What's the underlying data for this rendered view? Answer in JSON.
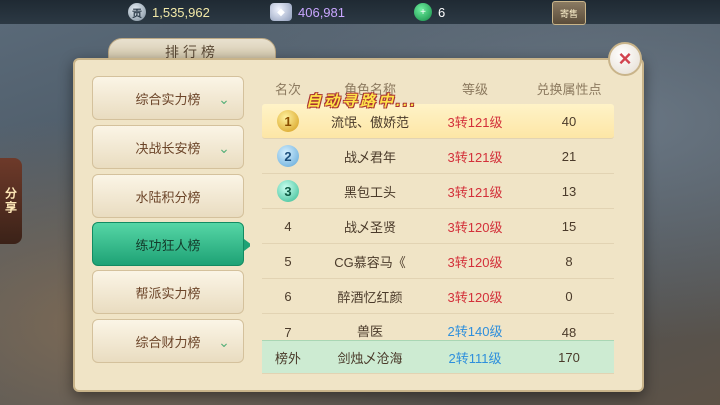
{
  "resources": {
    "copper": "1,535,962",
    "silver": "406,981",
    "jade": "6"
  },
  "topright_badge": "寄售",
  "share_label": "分享",
  "panel_title": "排行榜",
  "close_symbol": "×",
  "auto_text": "自动寻路中...",
  "tabs": [
    {
      "label": "综合实力榜",
      "has_chevron": true
    },
    {
      "label": "决战长安榜",
      "has_chevron": true
    },
    {
      "label": "水陆积分榜",
      "has_chevron": false
    },
    {
      "label": "练功狂人榜",
      "has_chevron": false,
      "active": true
    },
    {
      "label": "帮派实力榜",
      "has_chevron": false
    },
    {
      "label": "综合财力榜",
      "has_chevron": true
    }
  ],
  "table": {
    "headers": [
      "名次",
      "角色名称",
      "等级",
      "兑换属性点"
    ],
    "rows": [
      {
        "rank": "1",
        "name": "流氓、傲娇范",
        "level": "3转121级",
        "points": "40",
        "medal": "m1",
        "highlight": true
      },
      {
        "rank": "2",
        "name": "战乄君年",
        "level": "3转121级",
        "points": "21",
        "medal": "m2"
      },
      {
        "rank": "3",
        "name": "黑包工头",
        "level": "3转121级",
        "points": "13",
        "medal": "m3"
      },
      {
        "rank": "4",
        "name": "战乄圣贤",
        "level": "3转120级",
        "points": "15"
      },
      {
        "rank": "5",
        "name": "CG慕容马《",
        "level": "3转120级",
        "points": "8"
      },
      {
        "rank": "6",
        "name": "醉酒忆红颜",
        "level": "3转120级",
        "points": "0"
      },
      {
        "rank": "7",
        "name": "兽医",
        "level": "2转140级",
        "points": "48",
        "blue": true
      }
    ],
    "self_row": {
      "rank": "榜外",
      "name": "剑烛乄沧海",
      "level": "2转111级",
      "points": "170"
    }
  }
}
